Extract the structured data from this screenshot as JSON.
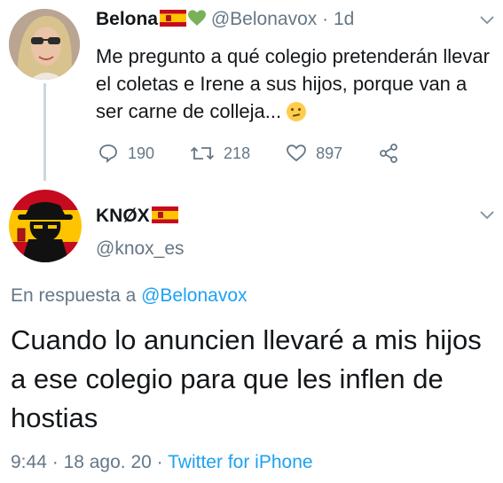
{
  "tweet1": {
    "display_name": "Belona",
    "handle": "@Belonavox",
    "separator": "·",
    "time": "1d",
    "text": "Me pregunto a qué colegio pretenderán llevar el coletas e Irene a sus hijos, porque van a ser carne de colleja...",
    "counts": {
      "replies": "190",
      "retweets": "218",
      "likes": "897"
    },
    "icons": [
      "flag-spain-icon",
      "green-heart-icon",
      "thinking-face-icon",
      "reply-icon",
      "retweet-icon",
      "like-icon",
      "share-icon",
      "chevron-down-icon"
    ]
  },
  "tweet2": {
    "display_name": "KNØX",
    "handle": "@knox_es",
    "reply_prefix": "En respuesta a",
    "reply_handle": "@Belonavox",
    "text": "Cuando lo anuncien llevaré a mis hijos a ese colegio para que les inflen de hostias",
    "time": "9:44",
    "date": "18 ago. 20",
    "dot": "·",
    "source": "Twitter for iPhone"
  },
  "colors": {
    "link": "#1da1f2",
    "muted": "#657786",
    "text": "#14171a",
    "thread_line": "#ccd6dd"
  }
}
